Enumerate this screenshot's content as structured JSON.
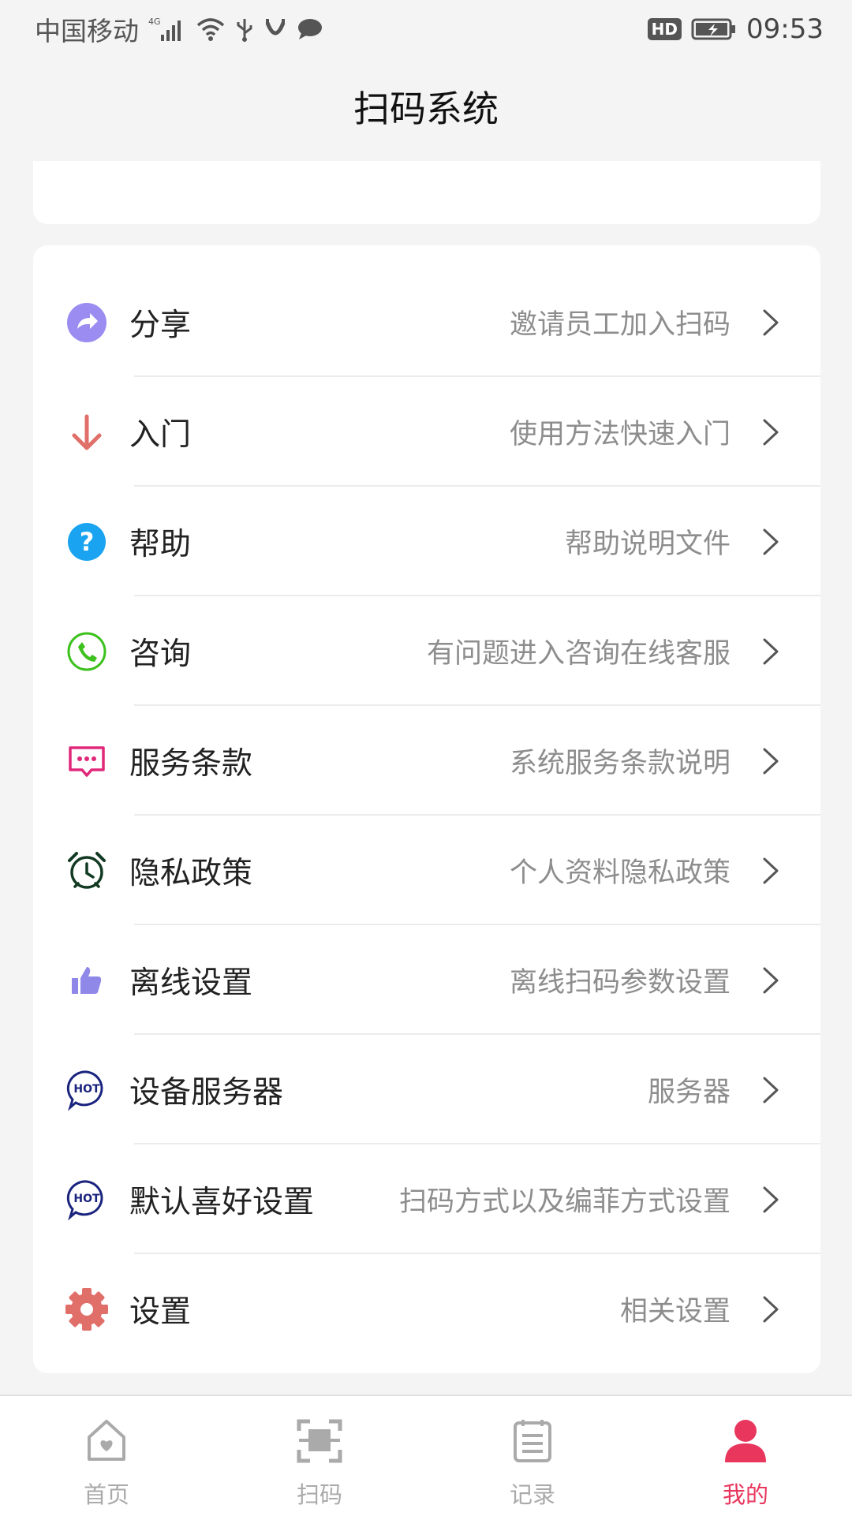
{
  "status_bar": {
    "carrier": "中国移动",
    "network": "4G",
    "hd": "HD",
    "time": "09:53"
  },
  "header": {
    "title": "扫码系统"
  },
  "menu": [
    {
      "label": "分享",
      "desc": "邀请员工加入扫码",
      "icon": "share-icon",
      "color": "#9a8cf0"
    },
    {
      "label": "入门",
      "desc": "使用方法快速入门",
      "icon": "arrow-down-icon",
      "color": "#e06f6a"
    },
    {
      "label": "帮助",
      "desc": "帮助说明文件",
      "icon": "help-icon",
      "color": "#1aa3f0"
    },
    {
      "label": "咨询",
      "desc": "有问题进入咨询在线客服",
      "icon": "phone-icon",
      "color": "#3cc11d"
    },
    {
      "label": "服务条款",
      "desc": "系统服务条款说明",
      "icon": "message-icon",
      "color": "#e0287a"
    },
    {
      "label": "隐私政策",
      "desc": "个人资料隐私政策",
      "icon": "alarm-clock-icon",
      "color": "#123a22"
    },
    {
      "label": "离线设置",
      "desc": "离线扫码参数设置",
      "icon": "thumbs-up-icon",
      "color": "#8f88e8"
    },
    {
      "label": "设备服务器",
      "desc": "服务器",
      "icon": "hot-icon",
      "color": "#1a237e"
    },
    {
      "label": "默认喜好设置",
      "desc": "扫码方式以及编菲方式设置",
      "icon": "hot-icon",
      "color": "#1a237e"
    },
    {
      "label": "设置",
      "desc": "相关设置",
      "icon": "gear-icon",
      "color": "#e06f6a"
    }
  ],
  "tabs": [
    {
      "label": "首页",
      "icon": "home-icon",
      "active": false
    },
    {
      "label": "扫码",
      "icon": "scan-icon",
      "active": false
    },
    {
      "label": "记录",
      "icon": "records-icon",
      "active": false
    },
    {
      "label": "我的",
      "icon": "user-icon",
      "active": true
    }
  ],
  "colors": {
    "accent": "#e8365d",
    "inactive_tab": "#aaaaaa"
  }
}
